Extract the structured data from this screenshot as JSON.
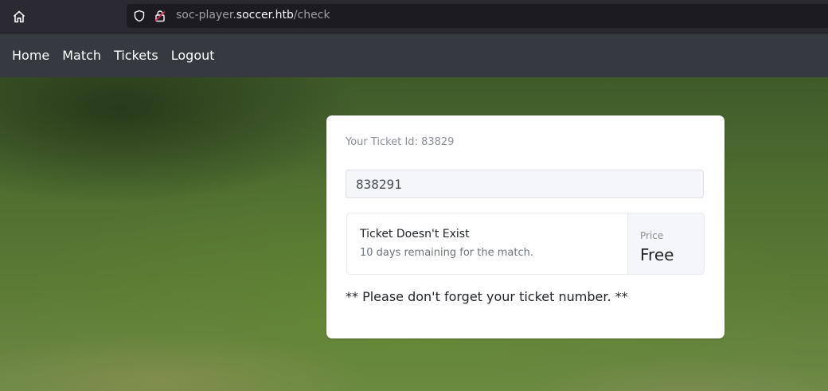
{
  "browser": {
    "url_prefix": "soc-player.",
    "url_host": "soccer.htb",
    "url_path": "/check"
  },
  "nav": {
    "items": [
      "Home",
      "Match",
      "Tickets",
      "Logout"
    ]
  },
  "card": {
    "ticket_id_label": "Your Ticket Id: 83829",
    "input_value": "838291",
    "result_title": "Ticket Doesn't Exist",
    "result_subtitle": "10 days remaining for the match.",
    "price_label": "Price",
    "price_value": "Free",
    "reminder": "** Please don't forget your ticket number. **"
  },
  "icons": {
    "home": "home-icon",
    "shield": "tracking-shield-icon",
    "lock": "insecure-lock-icon"
  },
  "colors": {
    "navbar_bg": "#343a40",
    "browser_bg": "#2b2a33",
    "card_bg": "#ffffff"
  }
}
